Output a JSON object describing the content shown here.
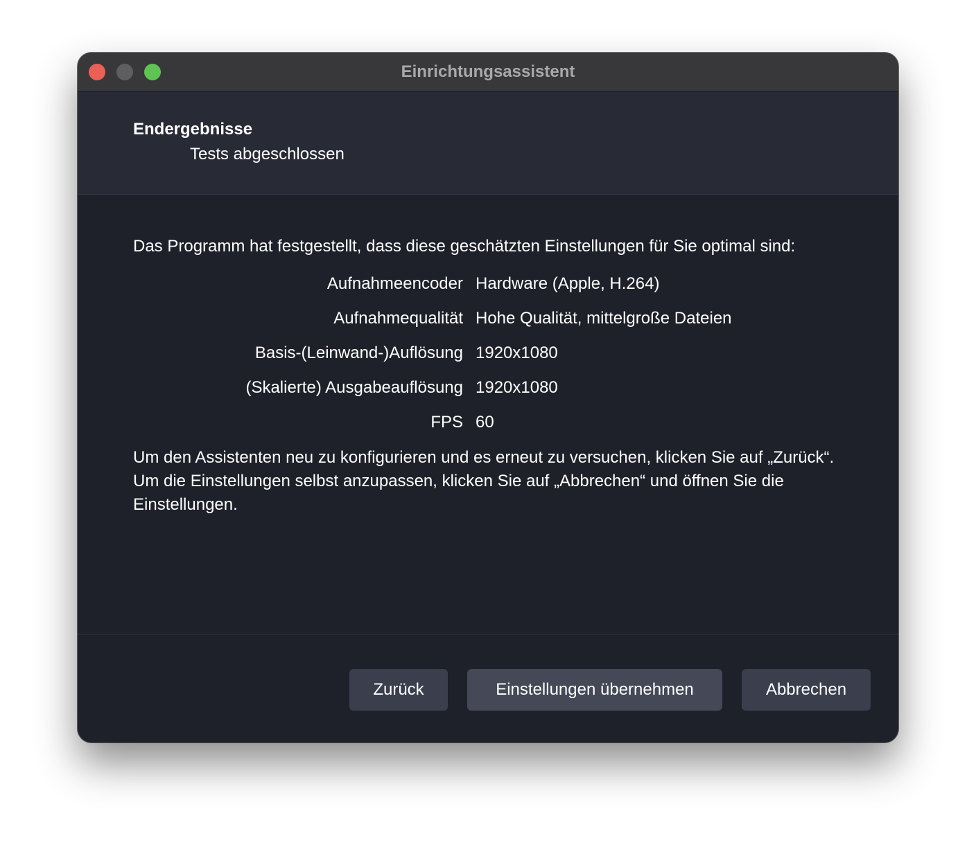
{
  "window": {
    "title": "Einrichtungsassistent"
  },
  "header": {
    "title": "Endergebnisse",
    "subtitle": "Tests abgeschlossen"
  },
  "content": {
    "intro": "Das Programm hat festgestellt, dass diese geschätzten Einstellungen für Sie optimal sind:",
    "settings": [
      {
        "label": "Aufnahmeencoder",
        "value": "Hardware (Apple, H.264)"
      },
      {
        "label": "Aufnahmequalität",
        "value": "Hohe Qualität, mittelgroße Dateien"
      },
      {
        "label": "Basis-(Leinwand-)Auflösung",
        "value": "1920x1080"
      },
      {
        "label": "(Skalierte) Ausgabeauflösung",
        "value": "1920x1080"
      },
      {
        "label": "FPS",
        "value": "60"
      }
    ],
    "outro": "Um den Assistenten neu zu konfigurieren und es erneut zu versuchen, klicken Sie auf „Zurück“. Um die Einstellungen selbst anzupassen, klicken Sie auf „Abbrechen“ und öffnen Sie die Einstellungen."
  },
  "buttons": {
    "back": "Zurück",
    "apply": "Einstellungen übernehmen",
    "cancel": "Abbrechen"
  },
  "colors": {
    "close": "#ec5f57",
    "minimize": "#5e5e60",
    "zoom": "#5ec452",
    "background": "#1f212a",
    "button": "#3b3e4c"
  }
}
